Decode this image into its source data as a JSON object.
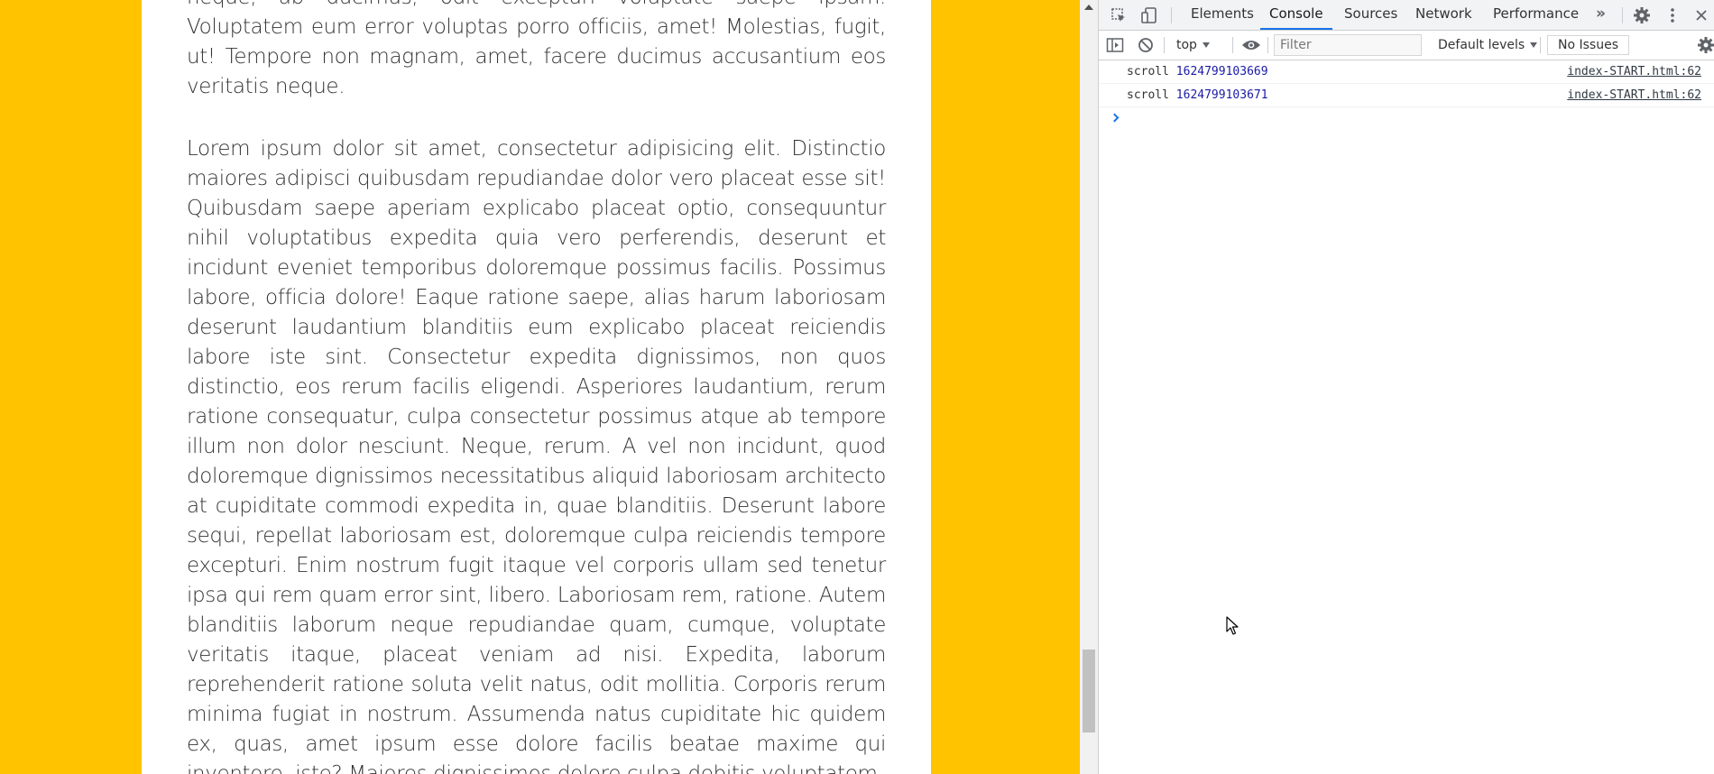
{
  "page": {
    "paragraphs": [
      "neque, ab ducimus, odit excepturi voluptate saepe ipsam. Voluptatem eum error voluptas porro officiis, amet! Molestias, fugit, ut! Tempore non magnam, amet, facere ducimus accusantium eos veritatis neque.",
      "Lorem ipsum dolor sit amet, consectetur adipisicing elit. Distinctio maiores adipisci quibusdam repudiandae dolor vero placeat esse sit! Quibusdam saepe aperiam explicabo placeat optio, consequuntur nihil voluptatibus expedita quia vero perferendis, deserunt et incidunt eveniet temporibus doloremque possimus facilis. Possimus labore, officia dolore! Eaque ratione saepe, alias harum laboriosam deserunt laudantium blanditiis eum explicabo placeat reiciendis labore iste sint. Consectetur expedita dignissimos, non quos distinctio, eos rerum facilis eligendi. Asperiores laudantium, rerum ratione consequatur, culpa consectetur possimus atque ab tempore illum non dolor nesciunt. Neque, rerum. A vel non incidunt, quod doloremque dignissimos necessitatibus aliquid laboriosam architecto at cupiditate commodi expedita in, quae blanditiis. Deserunt labore sequi, repellat laboriosam est, doloremque culpa reiciendis tempore excepturi. Enim nostrum fugit itaque vel corporis ullam sed tenetur ipsa qui rem quam error sint, libero. Laboriosam rem, ratione. Autem blanditiis laborum neque repudiandae quam, cumque, voluptate veritatis itaque, placeat veniam ad nisi. Expedita, laborum reprehenderit ratione soluta velit natus, odit mollitia. Corporis rerum minima fugiat in nostrum. Assumenda natus cupiditate hic quidem ex, quas, amet ipsum esse dolore facilis beatae maxime qui inventore, iste? Maiores dignissimos dolore culpa debitis voluptatem"
    ],
    "colors": {
      "page_background": "#ffc300",
      "card_background": "#ffffff",
      "text": "#333333"
    }
  },
  "devtools": {
    "tabs": {
      "elements": "Elements",
      "console": "Console",
      "sources": "Sources",
      "network": "Network",
      "performance": "Performance",
      "more": "»"
    },
    "active_tab": "console",
    "toolbar": {
      "context": "top",
      "filter_placeholder": "Filter",
      "levels": "Default levels",
      "issues": "No Issues"
    },
    "messages": [
      {
        "label": "scroll",
        "value": "1624799103669",
        "source": "index-START.html:62"
      },
      {
        "label": "scroll",
        "value": "1624799103671",
        "source": "index-START.html:62"
      }
    ],
    "icons": {
      "inspect": "inspect-element-icon",
      "device": "device-toolbar-icon",
      "settings": "gear-icon",
      "menu": "kebab-menu-icon",
      "close": "close-icon",
      "sidebar": "sidebar-toggle-icon",
      "clear": "clear-console-icon",
      "live_expression": "eye-icon",
      "prompt": "chevron-right-icon"
    },
    "colors": {
      "accent": "#1a73e8",
      "number": "#1a1aa6"
    }
  }
}
